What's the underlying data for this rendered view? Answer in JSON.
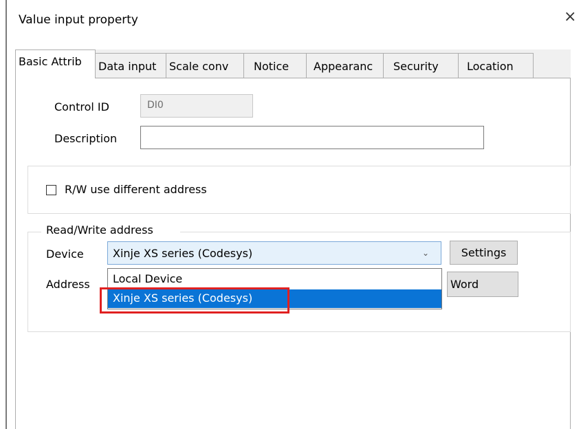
{
  "window": {
    "title": "Value input property",
    "close_label": "×"
  },
  "tabs": [
    {
      "label": "Basic Attrib",
      "active": true
    },
    {
      "label": "Data input",
      "active": false
    },
    {
      "label": "Scale conv",
      "active": false
    },
    {
      "label": "Notice",
      "active": false
    },
    {
      "label": "Appearanc",
      "active": false
    },
    {
      "label": "Security",
      "active": false
    },
    {
      "label": "Location",
      "active": false
    }
  ],
  "basic": {
    "control_id_label": "Control ID",
    "control_id_value": "DI0",
    "description_label": "Description",
    "description_value": "",
    "rw_diff_label": "R/W use different address",
    "rw_diff_checked": false
  },
  "rw_address": {
    "group_label": "Read/Write address",
    "device_label": "Device",
    "device_selected": "Xinje XS series (Codesys)",
    "settings_label": "Settings",
    "address_label": "Address",
    "word_label": "Word",
    "dropdown_options": [
      "Local Device",
      "Xinje XS series (Codesys)"
    ],
    "highlighted_option": "Xinje XS series (Codesys)"
  },
  "colors": {
    "highlight": "#0a74d6",
    "annotation": "#e02020",
    "combo_bg": "#e5f1fb"
  },
  "icons": {
    "close": "close-icon",
    "chevron": "chevron-down-icon"
  }
}
